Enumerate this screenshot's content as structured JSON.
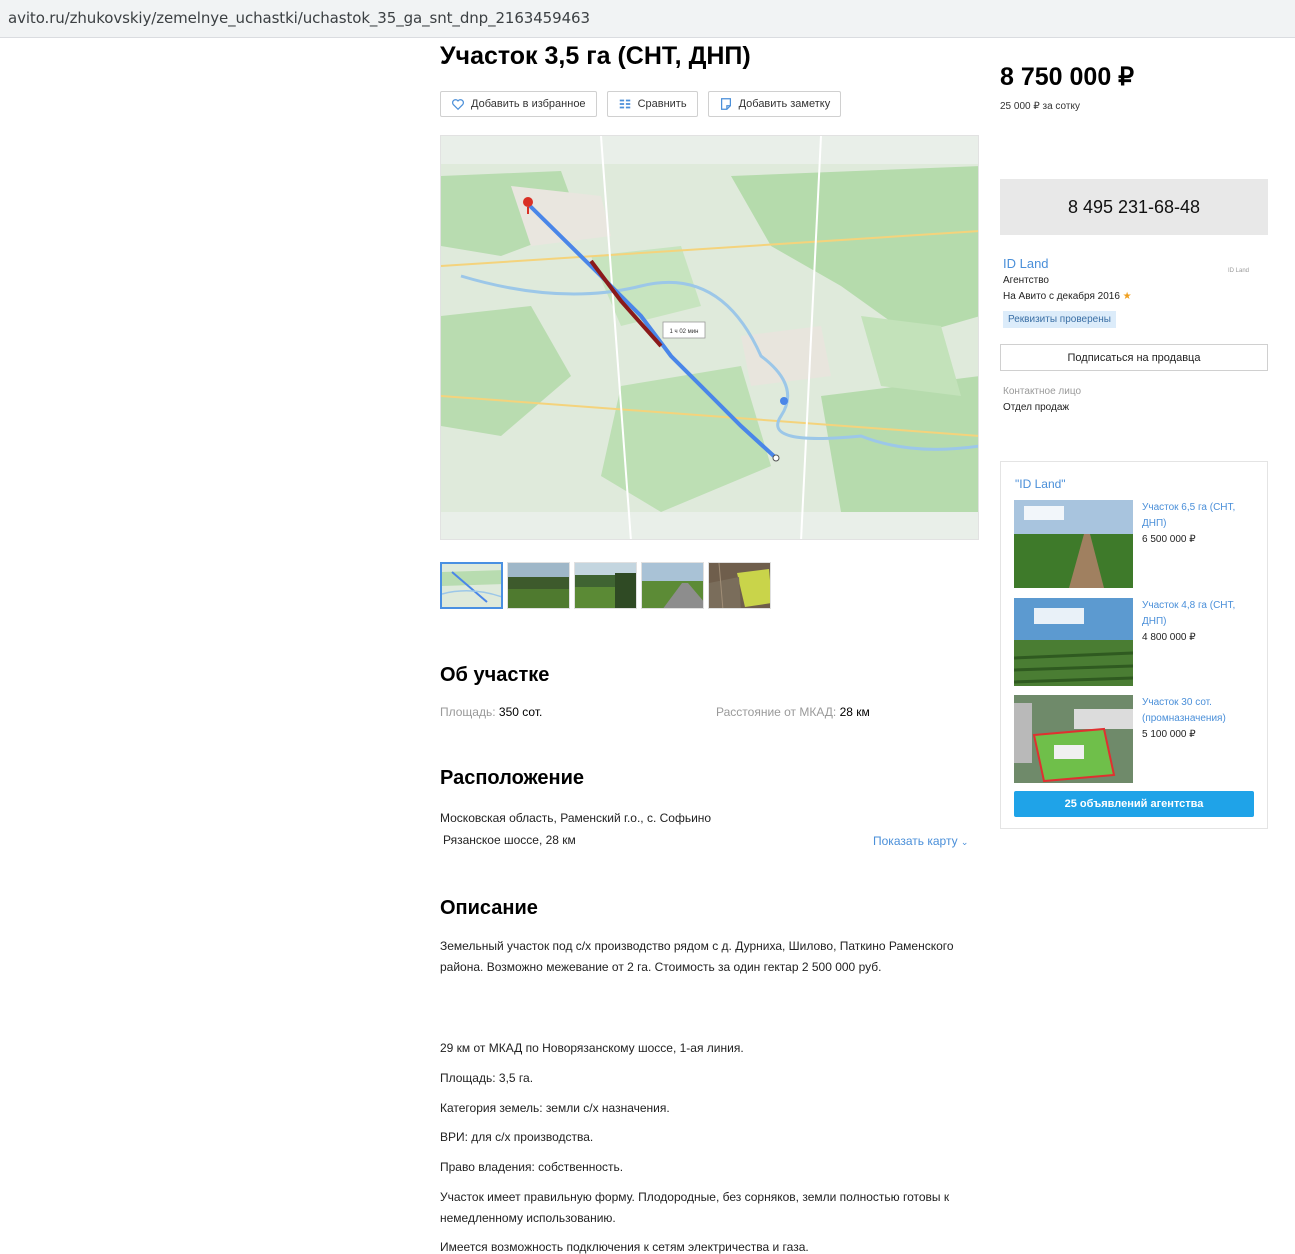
{
  "browser": {
    "url": "avito.ru/zhukovskiy/zemelnye_uchastki/uchastok_35_ga_snt_dnp_2163459463"
  },
  "listing": {
    "title": "Участок 3,5 га (СНТ, ДНП)",
    "actions": {
      "favorite": "Добавить в избранное",
      "compare": "Сравнить",
      "note": "Добавить заметку"
    },
    "map_route_label": "1 ч 02 мин"
  },
  "about": {
    "heading": "Об участке",
    "area_label": "Площадь:",
    "area_value": "350 сот.",
    "distance_label": "Расстояние от МКАД:",
    "distance_value": "28 км"
  },
  "location": {
    "heading": "Расположение",
    "address": "Московская область, Раменский г.о., с. Софьино",
    "highway": "Рязанское шоссе, 28 км",
    "show_map": "Показать карту"
  },
  "description": {
    "heading": "Описание",
    "p1": "Земельный участок под с/х производство рядом с д. Дурниха, Шилово, Паткино Раменского района. Возможно межевание от 2 га. Стоимость за один гектар 2 500 000 руб.",
    "p2": "29 км от МКАД по Новорязанскому шоссе, 1-ая линия.",
    "p3": "Площадь: 3,5 га.",
    "p4": "Категория земель: земли с/х назначения.",
    "p5": "ВРИ: для с/х производства.",
    "p6": "Право владения: собственность.",
    "p7": "Участок имеет правильную форму. Плодородные, без сорняков, земли полностью готовы к немедленному использованию.",
    "p8": "Имеется возможность подключения к сетям электричества и газа."
  },
  "price": {
    "value": "8 750 000 ₽",
    "per_unit": "25 000 ₽ за сотку"
  },
  "contact": {
    "phone": "8 495 231-68-48",
    "seller_name": "ID Land",
    "seller_type": "Агентство",
    "since": "На Авито с декабря 2016",
    "verified": "Реквизиты проверены",
    "subscribe": "Подписаться на продавца",
    "contact_label": "Контактное лицо",
    "contact_value": "Отдел продаж",
    "logo_text": "ID Land"
  },
  "agency_panel": {
    "title": "\"ID Land\"",
    "items": [
      {
        "title": "Участок 6,5 га (СНТ, ДНП)",
        "price": "6 500 000 ₽"
      },
      {
        "title": "Участок 4,8 га (СНТ, ДНП)",
        "price": "4 800 000 ₽"
      },
      {
        "title": "Участок 30 сот. (промназначения)",
        "price": "5 100 000 ₽"
      }
    ],
    "button": "25 объявлений агентства"
  },
  "colors": {
    "link": "#4a8fd9",
    "agency_button": "#1fa3e8",
    "route": "#4a86e8",
    "traffic": "#8b1a1a"
  }
}
